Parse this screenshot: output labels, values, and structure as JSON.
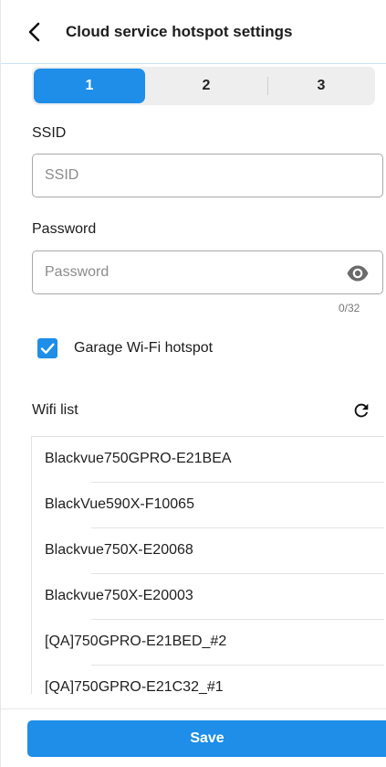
{
  "header": {
    "title": "Cloud service hotspot settings",
    "back_icon": "chevron-left-icon"
  },
  "tabs": [
    {
      "label": "1",
      "selected": true
    },
    {
      "label": "2",
      "selected": false
    },
    {
      "label": "3",
      "selected": false
    }
  ],
  "ssid": {
    "label": "SSID",
    "value": "",
    "placeholder": "SSID"
  },
  "password": {
    "label": "Password",
    "value": "",
    "placeholder": "Password",
    "counter": "0/32",
    "toggle_icon": "eye-icon"
  },
  "garage": {
    "label": "Garage Wi-Fi hotspot",
    "checked": true
  },
  "wifi_list": {
    "title": "Wifi list",
    "refresh_icon": "refresh-icon",
    "items": [
      "Blackvue750GPRO-E21BEA",
      "BlackVue590X-F10065",
      "Blackvue750X-E20068",
      "Blackvue750X-E20003",
      "[QA]750GPRO-E21BED_#2",
      "[QA]750GPRO-E21C32_#1"
    ]
  },
  "footer": {
    "save_label": "Save"
  },
  "colors": {
    "accent": "#1e8ee8",
    "segment_bg": "#eeeeef",
    "field_border": "#a8a8a8"
  }
}
